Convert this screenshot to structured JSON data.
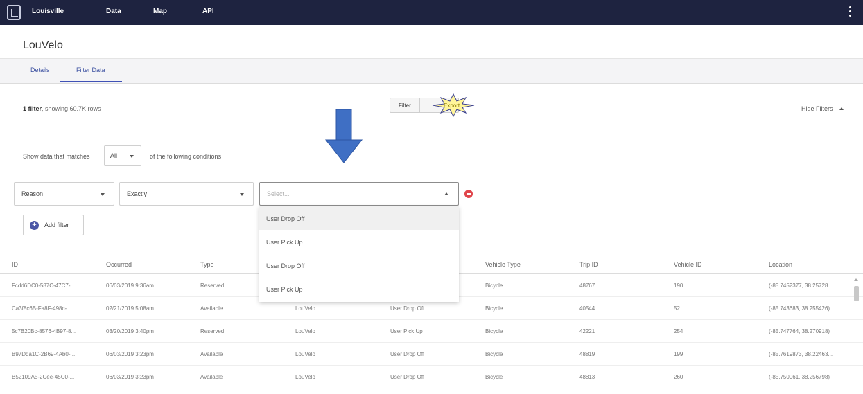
{
  "topbar": {
    "brand": "Louisville",
    "nav": [
      "Data",
      "Map",
      "API"
    ]
  },
  "header": {
    "title": "LouVelo",
    "tabs": [
      "Details",
      "Filter Data"
    ],
    "active_tab": "Filter Data"
  },
  "summary": {
    "filter_count": "1 filter",
    "text": ", showing 60.7K rows"
  },
  "actions": {
    "filter": "Filter",
    "export": "Export",
    "hide_filters": "Hide Filters"
  },
  "conditions": {
    "prefix": "Show data that matches",
    "match": "All",
    "suffix": "of the following conditions"
  },
  "filter_row": {
    "field": "Reason",
    "operator": "Exactly",
    "value_placeholder": "Select..."
  },
  "dropdown_options": [
    "User Drop Off",
    "User Pick Up",
    "User Drop Off",
    "User Pick Up"
  ],
  "add_filter": "Add filter",
  "table": {
    "columns": [
      "ID",
      "Occurred",
      "Type",
      "",
      "",
      "Vehicle Type",
      "Trip ID",
      "Vehicle ID",
      "Location"
    ],
    "rows": [
      [
        "Fcdd6DC0-587C-47C7-...",
        "06/03/2019 9:36am",
        "Reserved",
        "",
        "",
        "Bicycle",
        "48767",
        "190",
        "(-85.7452377, 38.25728..."
      ],
      [
        "Ca3f8c6B-Fa8F-498c-...",
        "02/21/2019 5:08am",
        "Available",
        "LouVelo",
        "User Drop Off",
        "Bicycle",
        "40544",
        "52",
        "(-85.743683, 38.255426)"
      ],
      [
        "5c7B20Bc-8576-4B97-8...",
        "03/20/2019 3:40pm",
        "Reserved",
        "LouVelo",
        "User Pick Up",
        "Bicycle",
        "42221",
        "254",
        "(-85.747764, 38.270918)"
      ],
      [
        "B97Dda1C-2B69-4Ab0-...",
        "06/03/2019 3:23pm",
        "Available",
        "LouVelo",
        "User Drop Off",
        "Bicycle",
        "48819",
        "199",
        "(-85.7619873, 38.22463..."
      ],
      [
        "B52109A5-2Cee-45C0-...",
        "06/03/2019 3:23pm",
        "Available",
        "LouVelo",
        "User Drop Off",
        "Bicycle",
        "48813",
        "260",
        "(-85.750061, 38.256798)"
      ]
    ]
  },
  "colors": {
    "topbar": "#1e2340",
    "accent": "#3f51b5",
    "remove": "#e0454b",
    "arrow": "#3f6fc4",
    "star": "#fff59a"
  }
}
